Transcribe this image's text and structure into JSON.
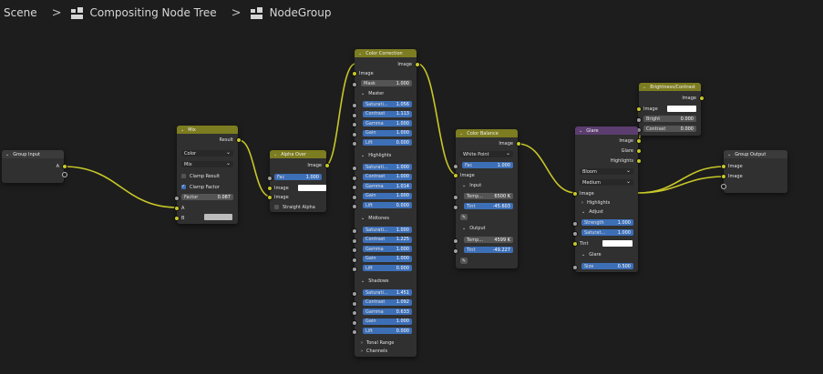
{
  "breadcrumb": {
    "scene": "Scene",
    "tree": "Compositing Node Tree",
    "group": "NodeGroup"
  },
  "colors": {
    "link": "#c7c729",
    "converter_header": "#7c7c20",
    "filter_header": "#5c3d6f",
    "group_header": "#3b3b3b"
  },
  "nodes": {
    "group_input": {
      "title": "Group Input",
      "out_a": "A"
    },
    "mix": {
      "title": "Mix",
      "out_result": "Result",
      "color_type": "Color",
      "blend": "Mix",
      "clamp_result": "Clamp Result",
      "clamp_factor": "Clamp Factor",
      "factor_label": "Factor",
      "factor_value": "0.087",
      "in_a": "A",
      "in_b": "B"
    },
    "alpha_over": {
      "title": "Alpha Over",
      "out_image": "Image",
      "fac_label": "Fac",
      "fac_value": "1.000",
      "in_image1": "Image",
      "in_image2": "Image",
      "straight_alpha": "Straight Alpha"
    },
    "color_correction": {
      "title": "Color Correction",
      "out_image": "Image",
      "in_image": "Image",
      "mask_label": "Mask",
      "mask_value": "1.000",
      "sections": [
        {
          "name": "Master",
          "rows": [
            [
              "Saturati...",
              "1.056"
            ],
            [
              "Contrast",
              "1.113"
            ],
            [
              "Gamma",
              "1.000"
            ],
            [
              "Gain",
              "1.000"
            ],
            [
              "Lift",
              "0.000"
            ]
          ]
        },
        {
          "name": "Highlights",
          "rows": [
            [
              "Saturati...",
              "1.000"
            ],
            [
              "Contrast",
              "1.000"
            ],
            [
              "Gamma",
              "1.014"
            ],
            [
              "Gain",
              "1.000"
            ],
            [
              "Lift",
              "0.000"
            ]
          ]
        },
        {
          "name": "Midtones",
          "rows": [
            [
              "Saturati...",
              "1.000"
            ],
            [
              "Contrast",
              "1.225"
            ],
            [
              "Gamma",
              "1.000"
            ],
            [
              "Gain",
              "1.000"
            ],
            [
              "Lift",
              "0.000"
            ]
          ]
        },
        {
          "name": "Shadows",
          "rows": [
            [
              "Saturati...",
              "1.451"
            ],
            [
              "Contrast",
              "1.092"
            ],
            [
              "Gamma",
              "0.633"
            ],
            [
              "Gain",
              "1.000"
            ],
            [
              "Lift",
              "0.000"
            ]
          ]
        }
      ],
      "tonal_range": "Tonal Range",
      "channels": "Channels"
    },
    "color_balance": {
      "title": "Color Balance",
      "out_image": "Image",
      "mode": "White Point",
      "fac_label": "Fac",
      "fac_value": "1.000",
      "in_image": "Image",
      "input_label": "Input",
      "input_temp_label": "Temp...",
      "input_temp_value": "6500 K",
      "input_tint_label": "Tint",
      "input_tint_value": "-45.603",
      "output_label": "Output",
      "output_temp_label": "Temp...",
      "output_temp_value": "4599 K",
      "output_tint_label": "Tint",
      "output_tint_value": "-49.227"
    },
    "brightness_contrast": {
      "title": "Brightness/Contrast",
      "out_image": "Image",
      "in_image": "Image",
      "bright_label": "Bright",
      "bright_value": "0.000",
      "contrast_label": "Contrast",
      "contrast_value": "0.000"
    },
    "glare": {
      "title": "Glare",
      "out_image": "Image",
      "out_glare": "Glare",
      "out_highlights": "Highlights",
      "type": "Bloom",
      "quality": "Medium",
      "in_image": "Image",
      "highlights_label": "Highlights",
      "adjust_label": "Adjust",
      "strength_label": "Strength",
      "strength_value": "1.000",
      "saturation_label": "Saturat...",
      "saturation_value": "1.000",
      "tint_label": "Tint",
      "glare_section": "Glare",
      "size_label": "Size",
      "size_value": "0.500"
    },
    "group_output": {
      "title": "Group Output",
      "in_image1": "Image",
      "in_image2": "Image"
    }
  }
}
